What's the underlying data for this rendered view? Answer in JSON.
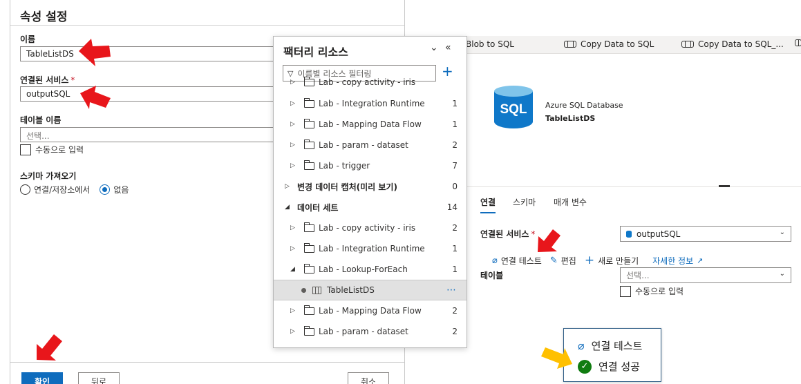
{
  "props": {
    "title": "속성 설정",
    "name_label": "이름",
    "name_value": "TableListDS",
    "linked_service_label": "연결된 서비스",
    "required_mark": "*",
    "linked_service_value": "outputSQL",
    "table_name_label": "테이블 이름",
    "table_name_placeholder": "선택...",
    "manual_entry_label": "수동으로 입력",
    "import_schema_label": "스키마 가져오기",
    "import_schema_options": [
      "연결/저장소에서",
      "없음"
    ],
    "import_schema_selected": "없음",
    "buttons": {
      "ok": "확인",
      "back": "뒤로",
      "cancel": "취소"
    }
  },
  "resources": {
    "title": "팩터리 리소스",
    "filter_placeholder": "이름별 리소스 필터링",
    "rows": [
      {
        "label": "Lab - copy activity - iris",
        "count": ""
      },
      {
        "label": "Lab - Integration Runtime",
        "count": "1"
      },
      {
        "label": "Lab - Mapping Data Flow",
        "count": "1"
      },
      {
        "label": "Lab - param - dataset",
        "count": "2"
      },
      {
        "label": "Lab - trigger",
        "count": "7"
      },
      {
        "label": "변경 데이터 캡처(미리 보기)",
        "count": "0"
      },
      {
        "label": "데이터 세트",
        "count": "14"
      },
      {
        "label": "Lab - copy activity - iris",
        "count": "2"
      },
      {
        "label": "Lab - Integration Runtime",
        "count": "1"
      },
      {
        "label": "Lab - Lookup-ForEach",
        "count": "1"
      },
      {
        "label": "TableListDS",
        "count": ""
      },
      {
        "label": "Lab - Mapping Data Flow",
        "count": "2"
      },
      {
        "label": "Lab - param - dataset",
        "count": "2"
      }
    ]
  },
  "tabs": [
    "Blob to SQL",
    "Copy Data to SQL",
    "Copy Data to SQL_..."
  ],
  "dataset": {
    "type": "Azure SQL Database",
    "name": "TableListDS",
    "icon_text": "SQL"
  },
  "panel": {
    "tabs": [
      "연결",
      "스키마",
      "매개 변수"
    ],
    "linked_service_label": "연결된 서비스",
    "linked_service_value": "outputSQL",
    "actions": {
      "test": "연결 테스트",
      "edit": "편집",
      "new": "새로 만들기",
      "info": "자세한 정보"
    },
    "table_label": "테이블",
    "table_placeholder": "선택...",
    "manual_entry_label": "수동으로 입력"
  },
  "toast": {
    "test_label": "연결 테스트",
    "success_label": "연결 성공"
  },
  "colors": {
    "accent": "#0f6cbd",
    "arrow_red": "#e8161b",
    "arrow_yellow": "#ffc000",
    "success": "#107c10"
  }
}
